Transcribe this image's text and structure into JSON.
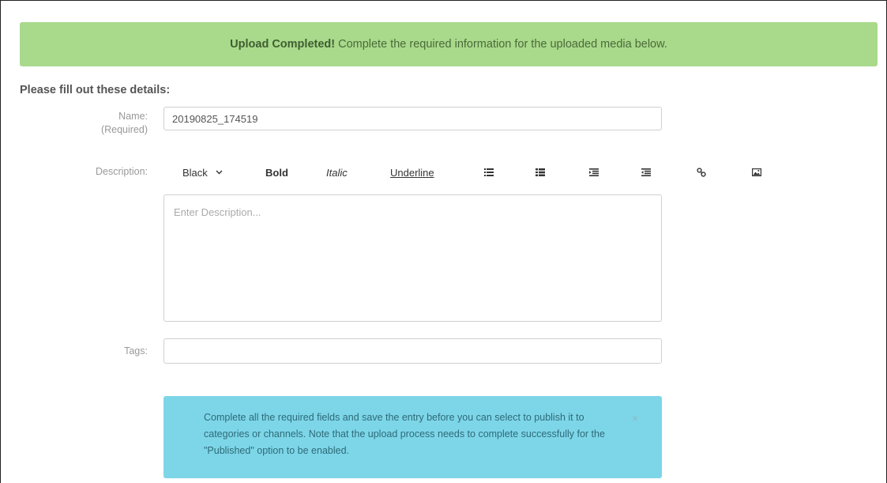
{
  "banner": {
    "strong": "Upload Completed!",
    "text": "Complete the required information for the uploaded media below."
  },
  "form": {
    "section_title": "Please fill out these details:",
    "name": {
      "label": "Name:",
      "sublabel": "(Required)",
      "value": "20190825_174519"
    },
    "description": {
      "label": "Description:",
      "placeholder": "Enter Description..."
    },
    "tags": {
      "label": "Tags:",
      "value": ""
    }
  },
  "toolbar": {
    "color_label": "Black",
    "bold_label": "Bold",
    "italic_label": "Italic",
    "underline_label": "Underline",
    "icons": [
      "unordered-list-icon",
      "ordered-list-icon",
      "outdent-icon",
      "indent-icon",
      "link-icon",
      "image-icon"
    ]
  },
  "alert": {
    "text": "Complete all the required fields and save the entry before you can select to publish it to categories or channels. Note that the upload process needs to complete successfully for the \"Published\" option to be enabled.",
    "close": "×"
  },
  "colors": {
    "banner_bg": "#a9d98b",
    "alert_bg": "#7dd6e8"
  }
}
